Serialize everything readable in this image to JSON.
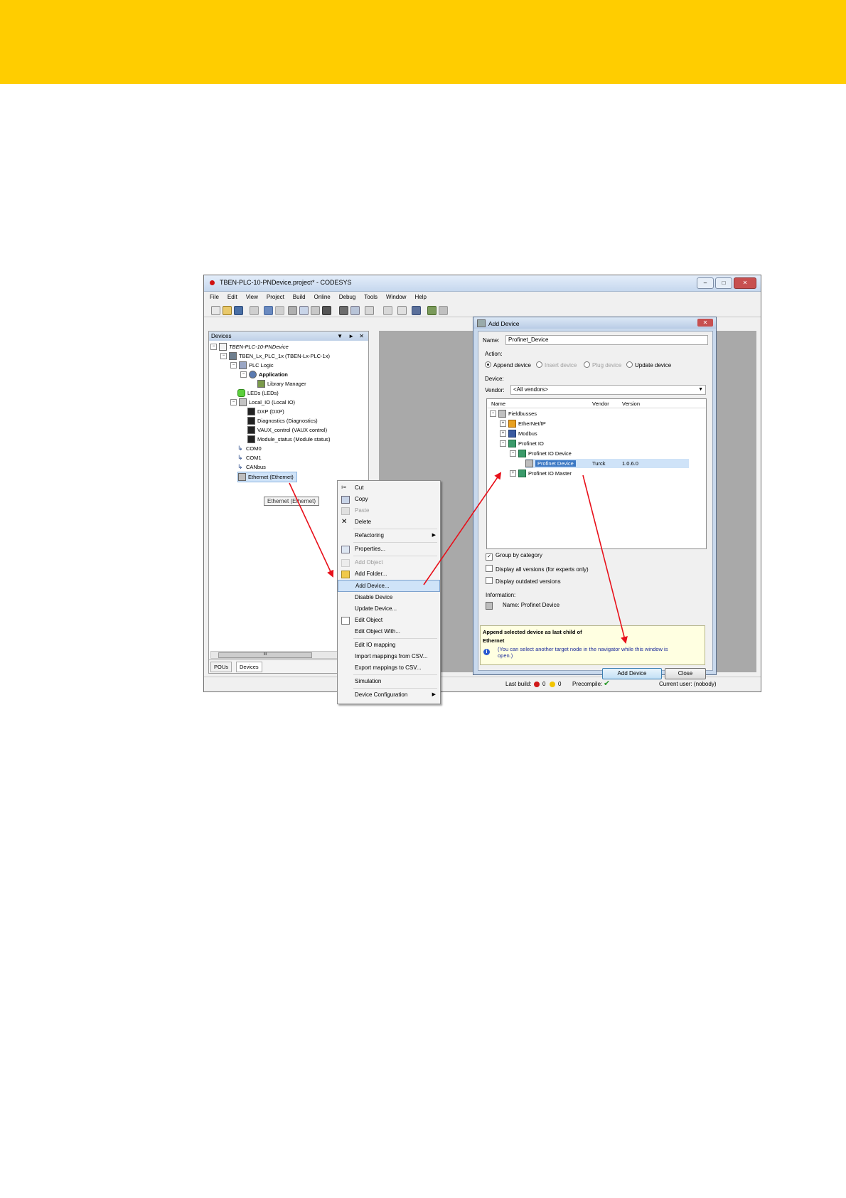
{
  "window": {
    "title": "TBEN-PLC-10-PNDevice.project* - CODESYS"
  },
  "menubar": [
    "File",
    "Edit",
    "View",
    "Project",
    "Build",
    "Online",
    "Debug",
    "Tools",
    "Window",
    "Help"
  ],
  "devices_panel": {
    "title": "Devices",
    "tree": [
      {
        "label": "TBEN-PLC-10-PNDevice",
        "icon": "project-icon"
      },
      {
        "label": "TBEN_Lx_PLC_1x (TBEN-Lx-PLC-1x)",
        "icon": "plc-icon"
      },
      {
        "label": "PLC Logic",
        "icon": "plc-logic-icon"
      },
      {
        "label": "Application",
        "icon": "application-icon"
      },
      {
        "label": "Library Manager",
        "icon": "library-icon"
      },
      {
        "label": "LEDs (LEDs)",
        "icon": "led-icon"
      },
      {
        "label": "Local_IO (Local IO)",
        "icon": "io-module-icon"
      },
      {
        "label": "DXP (DXP)",
        "icon": "io-channel-icon"
      },
      {
        "label": "Diagnostics (Diagnostics)",
        "icon": "io-channel-icon"
      },
      {
        "label": "VAUX_control (VAUX control)",
        "icon": "io-channel-icon"
      },
      {
        "label": "Module_status (Module status)",
        "icon": "io-channel-icon"
      },
      {
        "label": "COM0",
        "icon": "serial-port-icon"
      },
      {
        "label": "COM1",
        "icon": "serial-port-icon"
      },
      {
        "label": "CANbus",
        "icon": "can-bus-icon"
      },
      {
        "label": "Ethernet (Ethernet)",
        "icon": "ethernet-icon"
      }
    ],
    "tooltip": "Ethernet (Ethernet)",
    "scroll_label": "III",
    "tabs": [
      "POUs",
      "Devices"
    ]
  },
  "context_menu": {
    "items": [
      {
        "label": "Cut",
        "icon": "cut-icon",
        "enabled": true
      },
      {
        "label": "Copy",
        "icon": "copy-icon",
        "enabled": true
      },
      {
        "label": "Paste",
        "icon": "paste-icon",
        "enabled": false
      },
      {
        "label": "Delete",
        "icon": "delete-icon",
        "enabled": true
      },
      {
        "label": "Refactoring",
        "submenu": true,
        "enabled": true
      },
      {
        "label": "Properties...",
        "icon": "properties-icon",
        "enabled": true
      },
      {
        "label": "Add Object",
        "icon": "add-object-icon",
        "enabled": false
      },
      {
        "label": "Add Folder...",
        "icon": "folder-icon",
        "enabled": true
      },
      {
        "label": "Add Device...",
        "enabled": true,
        "highlighted": true
      },
      {
        "label": "Disable Device",
        "enabled": true
      },
      {
        "label": "Update Device...",
        "enabled": true
      },
      {
        "label": "Edit Object",
        "icon": "edit-object-icon",
        "enabled": true
      },
      {
        "label": "Edit Object With...",
        "enabled": true
      },
      {
        "label": "Edit IO mapping",
        "enabled": true
      },
      {
        "label": "Import mappings from CSV...",
        "enabled": true
      },
      {
        "label": "Export mappings to CSV...",
        "enabled": true
      },
      {
        "label": "Simulation",
        "enabled": true
      },
      {
        "label": "Device Configuration",
        "submenu": true,
        "enabled": true
      }
    ]
  },
  "dialog": {
    "title": "Add Device",
    "name_label": "Name:",
    "name_value": "Profinet_Device",
    "action_label": "Action:",
    "actions": [
      {
        "label": "Append device",
        "selected": true,
        "enabled": true
      },
      {
        "label": "Insert device",
        "selected": false,
        "enabled": false
      },
      {
        "label": "Plug device",
        "selected": false,
        "enabled": false
      },
      {
        "label": "Update device",
        "selected": false,
        "enabled": true
      }
    ],
    "device_label": "Device:",
    "vendor_label": "Vendor:",
    "vendor_value": "<All vendors>",
    "columns": [
      "Name",
      "Vendor",
      "Version"
    ],
    "tree": [
      {
        "name": "Fieldbusses",
        "vendor": "",
        "version": ""
      },
      {
        "name": "EtherNet/IP",
        "vendor": "",
        "version": ""
      },
      {
        "name": "Modbus",
        "vendor": "",
        "version": ""
      },
      {
        "name": "Profinet IO",
        "vendor": "",
        "version": ""
      },
      {
        "name": "Profinet IO Device",
        "vendor": "",
        "version": ""
      },
      {
        "name": "Profinet Device",
        "vendor": "Turck",
        "version": "1.0.6.0"
      },
      {
        "name": "Profinet IO Master",
        "vendor": "",
        "version": ""
      }
    ],
    "options": [
      {
        "label": "Group by category",
        "checked": true
      },
      {
        "label": "Display all versions (for experts only)",
        "checked": false
      },
      {
        "label": "Display outdated versions",
        "checked": false
      }
    ],
    "information_label": "Information:",
    "info_name": "Name: Profinet Device",
    "append_text_1": "Append selected device as last child of",
    "append_text_2": "Ethernet",
    "hint": "(You can select another target node in the navigator while this window is open.)",
    "add_button": "Add Device",
    "close_button": "Close"
  },
  "status": {
    "last_build_label": "Last build:",
    "errors": "0",
    "warnings": "0",
    "precompile_label": "Precompile:",
    "current_user": "Current user: (nobody)"
  },
  "colors": {
    "banner": "#ffcd00",
    "arrow": "#e8101a",
    "highlight": "#cfe3f8"
  }
}
